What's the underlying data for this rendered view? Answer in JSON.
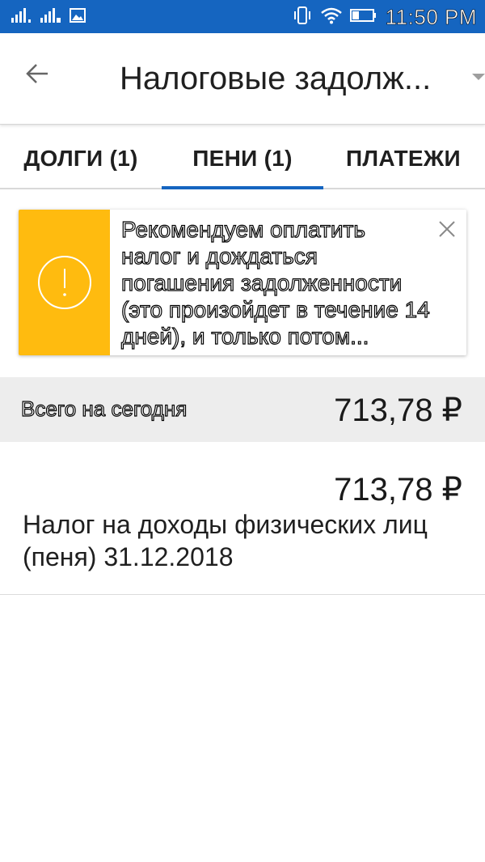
{
  "status_bar": {
    "time": "11:50 PM",
    "icons": [
      "signal-sim1-icon",
      "signal-sim2-icon",
      "image-notification-icon",
      "vibrate-icon",
      "wifi-icon",
      "battery-icon"
    ]
  },
  "app_bar": {
    "title": "Налоговые задолж..."
  },
  "tabs": [
    {
      "label": "ДОЛГИ (1)",
      "selected": false
    },
    {
      "label": "ПЕНИ (1)",
      "selected": true
    },
    {
      "label": "ПЛАТЕЖИ",
      "selected": false
    }
  ],
  "warning": {
    "text": "Рекомендуем оплатить налог и дождаться погашения задолженности (это произойдет в течение 14 дней), и только потом...",
    "accent_color": "#ffbb0f"
  },
  "total": {
    "label": "Всего на сегодня",
    "amount": "713,78 ₽"
  },
  "items": [
    {
      "amount": "713,78 ₽",
      "description": "Налог на доходы физических лиц (пеня) 31.12.2018"
    }
  ],
  "colors": {
    "primary": "#1565c0",
    "total_bg": "#ededed"
  }
}
